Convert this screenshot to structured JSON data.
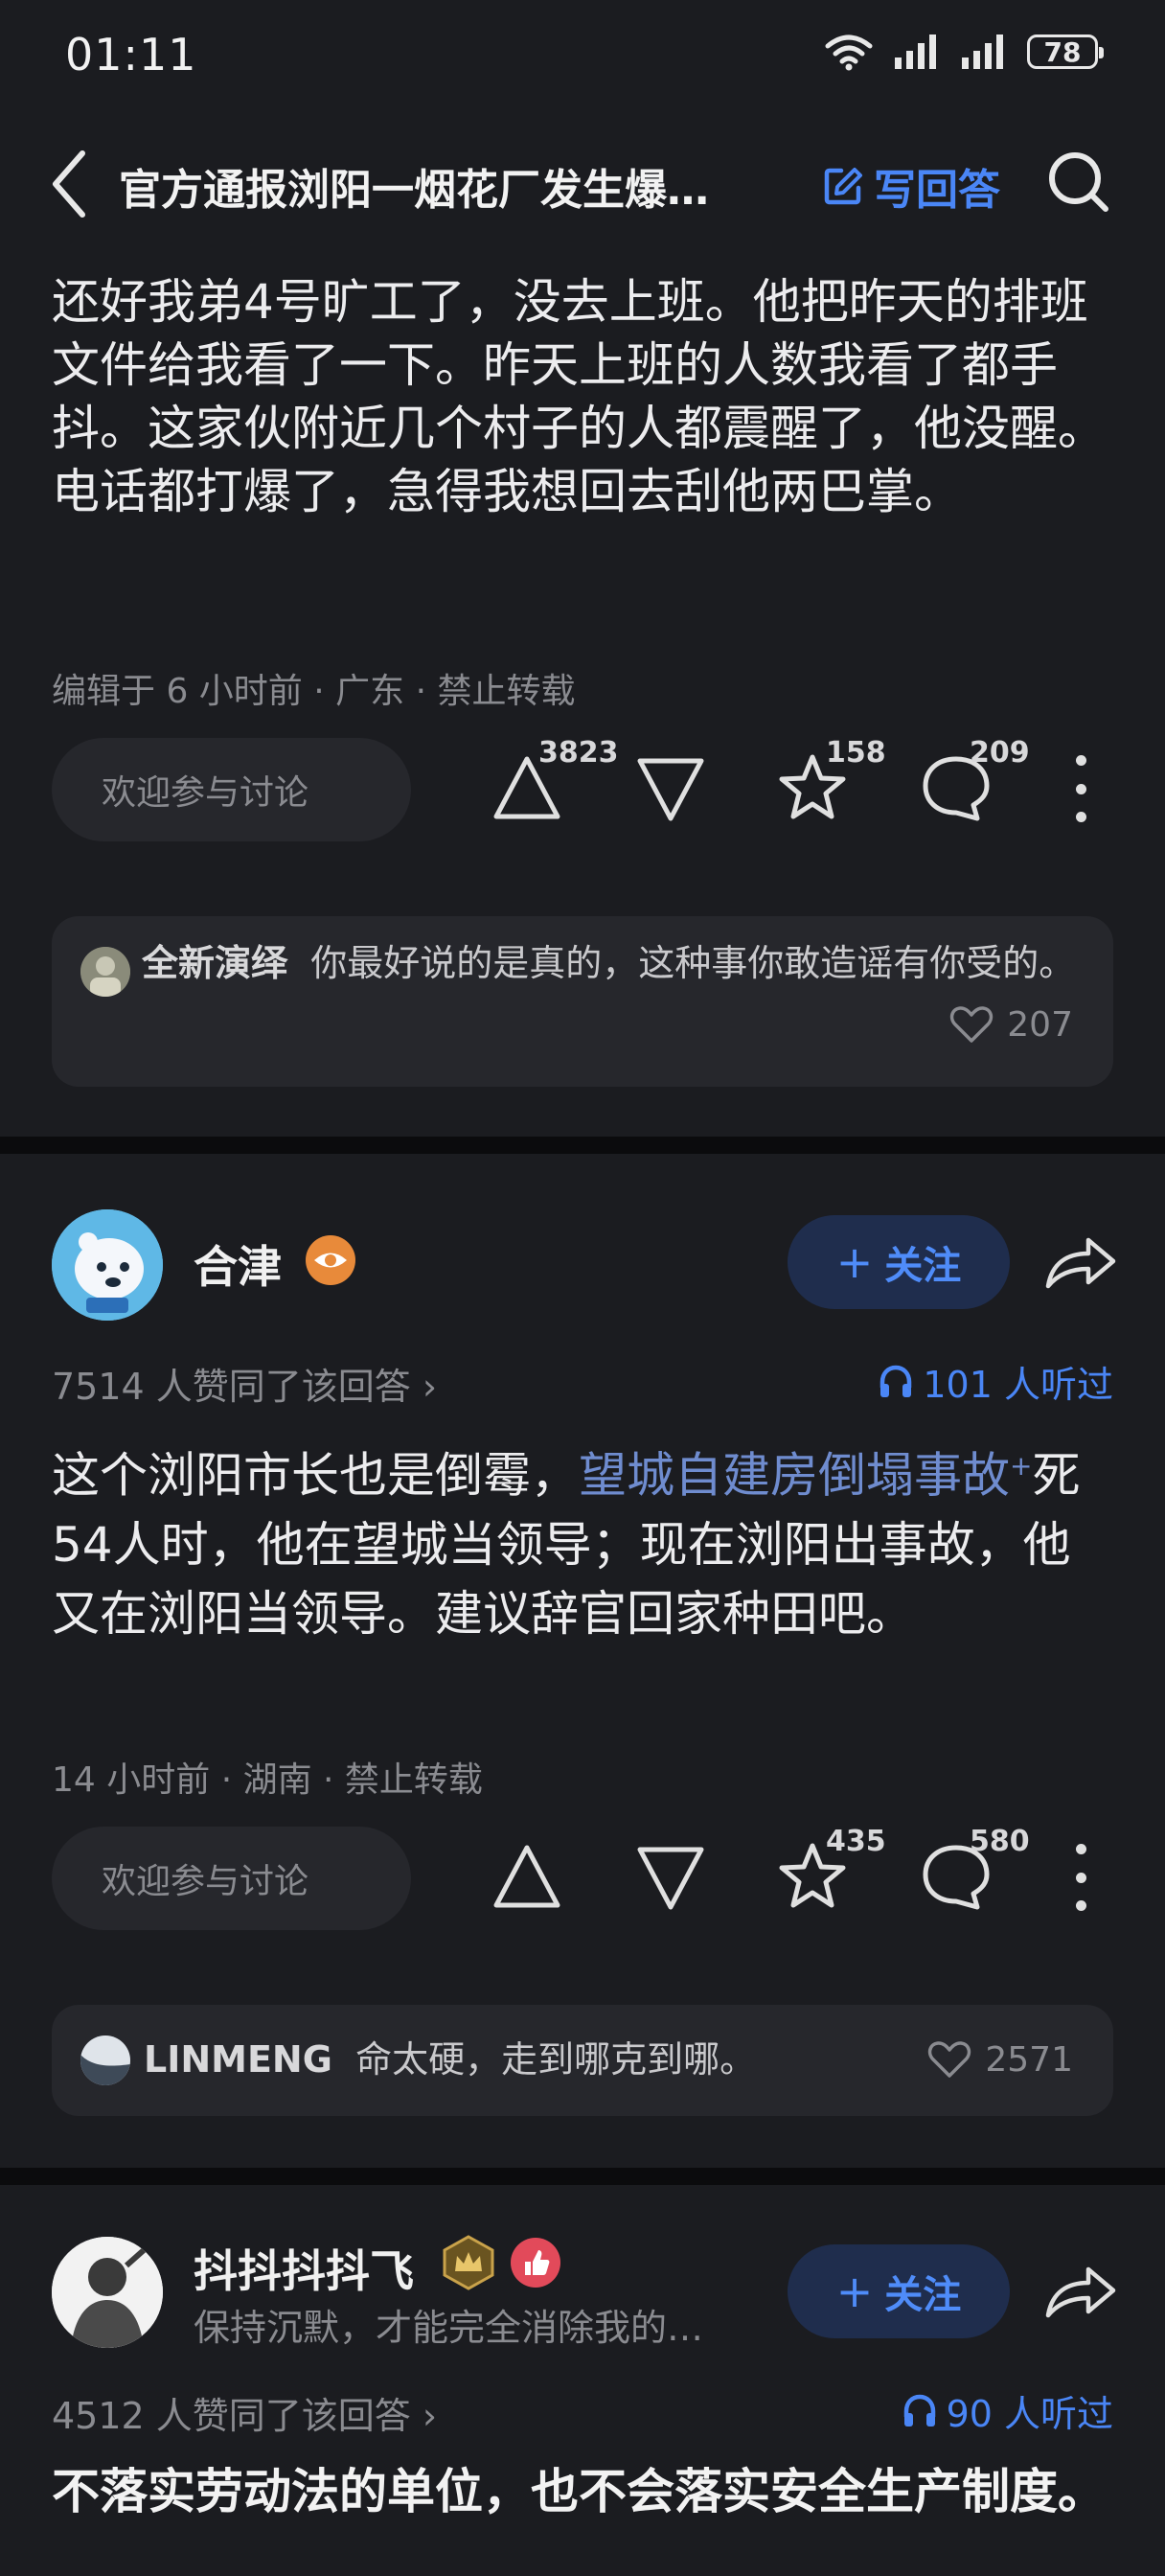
{
  "status": {
    "time": "01:11",
    "battery": "78"
  },
  "header": {
    "title": "官方通报浏阳一烟花厂发生爆…",
    "write_label": "写回答"
  },
  "answer1": {
    "text": "还好我弟4号旷工了，没去上班。他把昨天的排班文件给我看了一下。昨天上班的人数我看了都手抖。这家伙附近几个村子的人都震醒了，他没醒。电话都打爆了，急得我想回去刮他两巴掌。",
    "meta": "编辑于 6 小时前 · 广东 · 禁止转载",
    "input_placeholder": "欢迎参与讨论",
    "upvotes": "3823",
    "favorites": "158",
    "comments": "209",
    "comment": {
      "author": "全新演绎",
      "text": "你最好说的是真的，这种事你敢造谣有你受的。",
      "likes": "207"
    }
  },
  "answer2": {
    "author": "合津",
    "follow_label": "关注",
    "agree": "7514 人赞同了该回答 ›",
    "listen": "101 人听过",
    "text_before": "这个浏阳市长也是倒霉，",
    "link": "望城自建房倒塌事故",
    "text_after": "死54人时，他在望城当领导；现在浏阳出事故，他又在浏阳当领导。建议辞官回家种田吧。",
    "meta": "14 小时前 · 湖南 · 禁止转载",
    "input_placeholder": "欢迎参与讨论",
    "favorites": "435",
    "comments": "580",
    "comment": {
      "author": "LINMENG",
      "text": "命太硬，走到哪克到哪。",
      "likes": "2571"
    }
  },
  "answer3": {
    "author": "抖抖抖抖飞",
    "bio": "保持沉默，才能完全消除我的…",
    "follow_label": "关注",
    "agree": "4512 人赞同了该回答 ›",
    "listen": "90 人听过",
    "text": "不落实劳动法的单位，也不会落实安全生产制度。"
  },
  "colors": {
    "accent": "#4a86f6",
    "background": "#1b1c20",
    "card": "#26272c"
  }
}
